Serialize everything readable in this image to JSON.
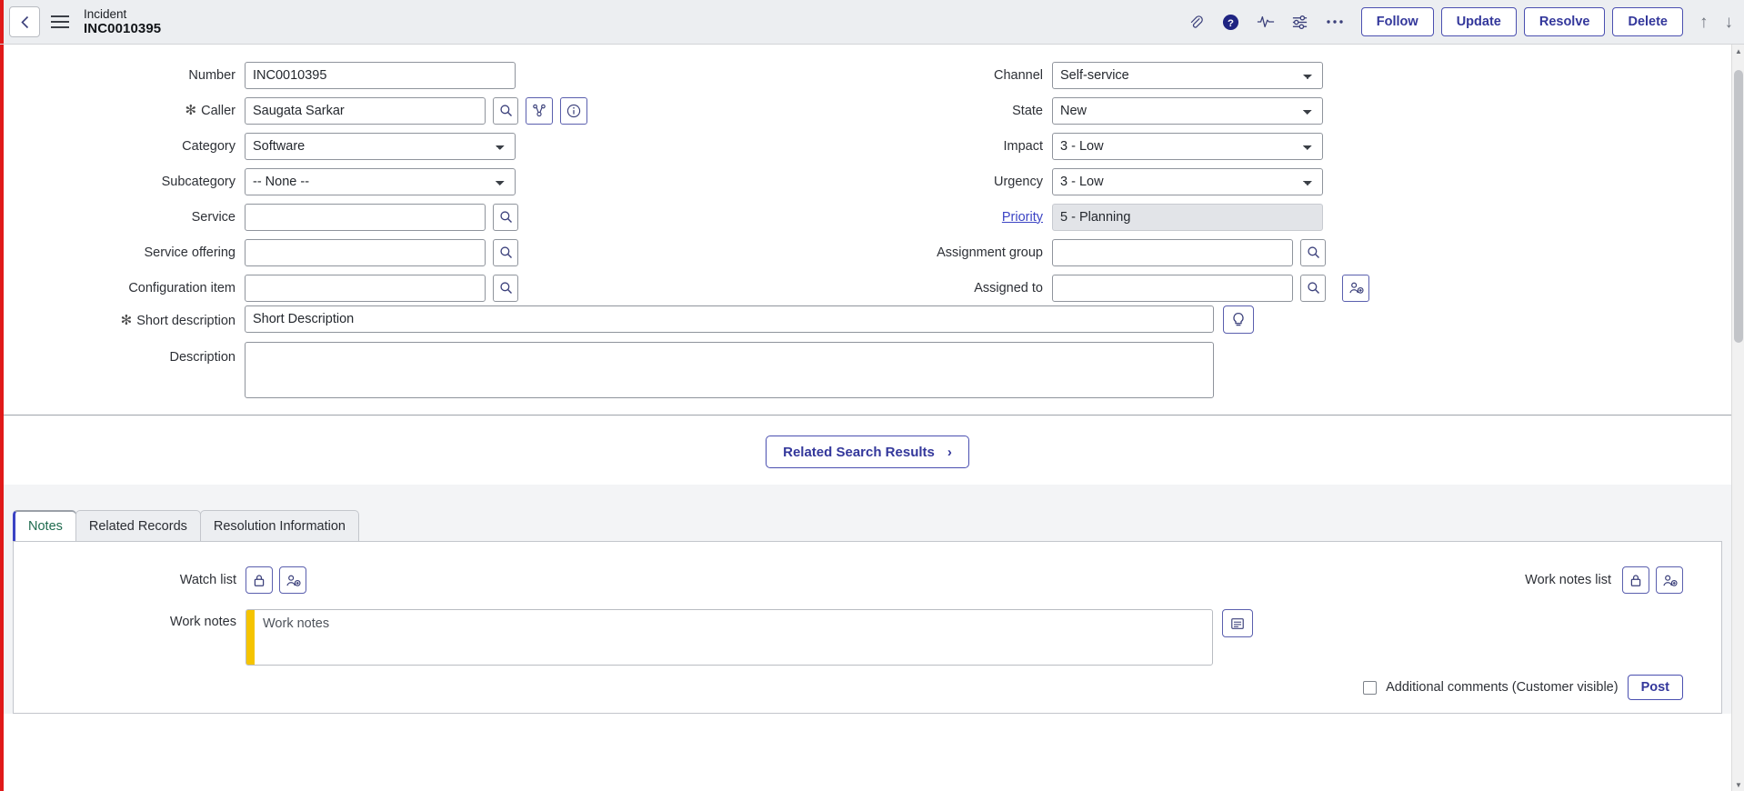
{
  "header": {
    "record_type": "Incident",
    "record_number": "INC0010395",
    "back_icon": "chevron-left-icon",
    "menu_icon": "hamburger-icon",
    "icons": [
      "attachment-icon",
      "help-icon",
      "activity-icon",
      "personalize-icon",
      "more-icon"
    ],
    "buttons": [
      "Follow",
      "Update",
      "Resolve",
      "Delete"
    ],
    "nav_up": "↑",
    "nav_down": "↓"
  },
  "form": {
    "left": {
      "number_label": "Number",
      "number_value": "INC0010395",
      "caller_label": "Caller",
      "caller_value": "Saugata Sarkar",
      "category_label": "Category",
      "category_value": "Software",
      "subcategory_label": "Subcategory",
      "subcategory_value": "-- None --",
      "service_label": "Service",
      "service_value": "",
      "service_offering_label": "Service offering",
      "service_offering_value": "",
      "configuration_item_label": "Configuration item",
      "configuration_item_value": ""
    },
    "right": {
      "channel_label": "Channel",
      "channel_value": "Self-service",
      "state_label": "State",
      "state_value": "New",
      "impact_label": "Impact",
      "impact_value": "3 - Low",
      "urgency_label": "Urgency",
      "urgency_value": "3 - Low",
      "priority_label": "Priority",
      "priority_value": "5 - Planning",
      "assignment_group_label": "Assignment group",
      "assignment_group_value": "",
      "assigned_to_label": "Assigned to",
      "assigned_to_value": ""
    },
    "short_description_label": "Short description",
    "short_description_value": "Short Description",
    "description_label": "Description",
    "description_value": "",
    "required_marker": "✻"
  },
  "related_search": {
    "label": "Related Search Results",
    "chevron": "›"
  },
  "tabs": [
    {
      "label": "Notes",
      "active": true
    },
    {
      "label": "Related Records",
      "active": false
    },
    {
      "label": "Resolution Information",
      "active": false
    }
  ],
  "notes": {
    "watch_list_label": "Watch list",
    "work_notes_list_label": "Work notes list",
    "work_notes_label": "Work notes",
    "work_notes_placeholder": "Work notes",
    "additional_comments_label": "Additional comments (Customer visible)",
    "post_label": "Post"
  },
  "colors": {
    "accent_red": "#e01919",
    "brand_purple": "#33379b",
    "work_note_yellow": "#f5c400",
    "link_blue": "#3b43c4"
  }
}
